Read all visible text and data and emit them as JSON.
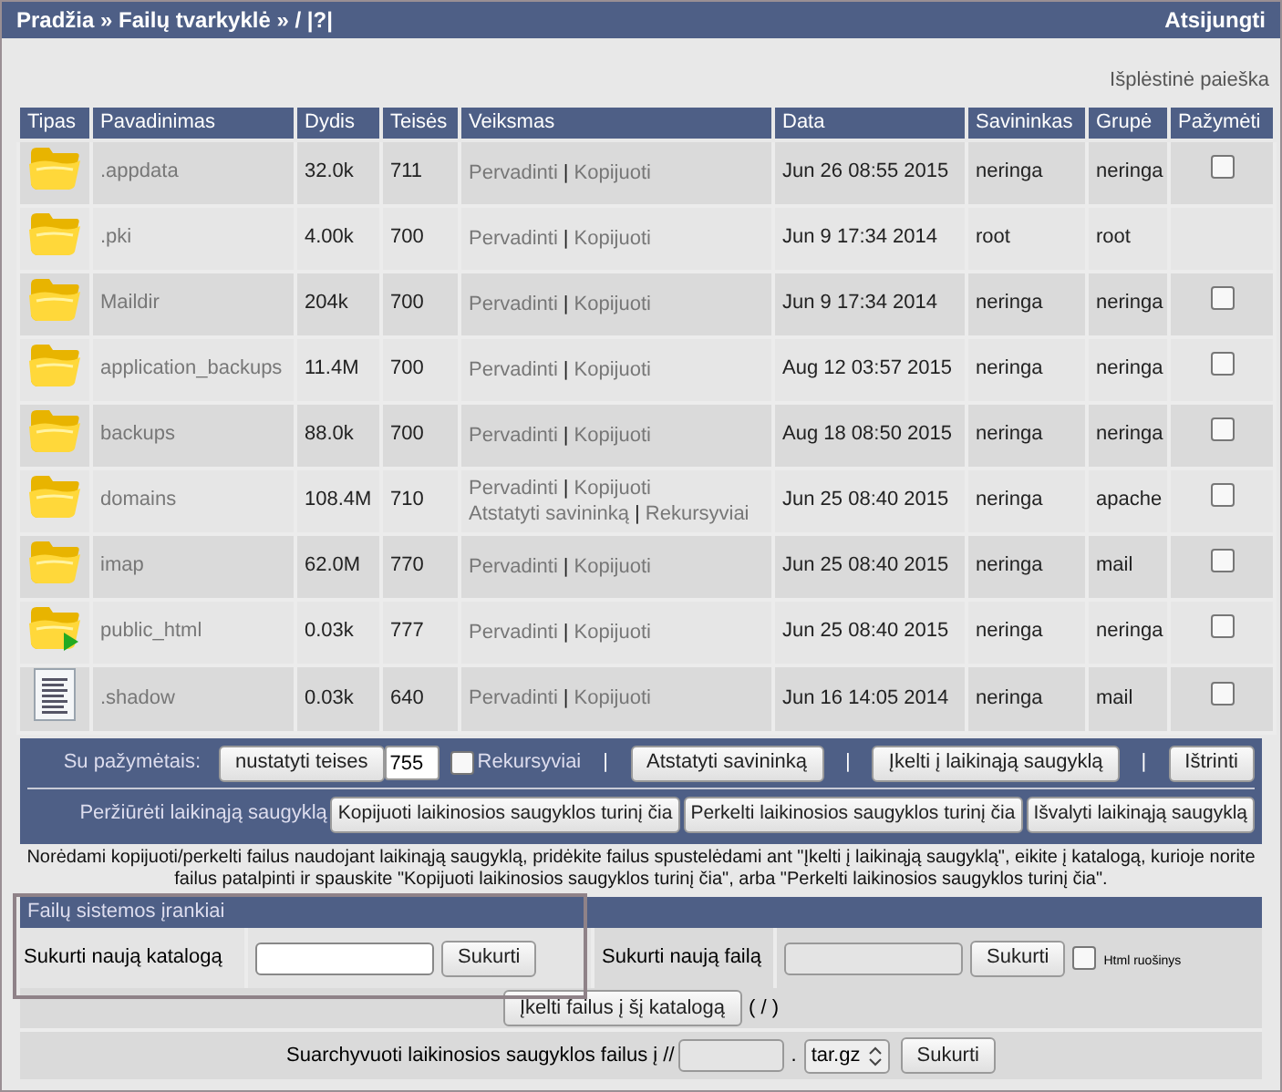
{
  "top_bar": {
    "breadcrumb": "Pradžia » Failų tvarkyklė » / |?|",
    "logout": "Atsijungti"
  },
  "advanced_search": "Išplėstinė paieška",
  "table": {
    "columns": [
      "Tipas",
      "Pavadinimas",
      "Dydis",
      "Teisės",
      "Veiksmas",
      "Data",
      "Savininkas",
      "Grupė",
      "Pažymėti"
    ],
    "rows": [
      {
        "kind": "folder",
        "name": ".appdata",
        "size": "32.0k",
        "perms": "711",
        "actions": [
          [
            {
              "kind": "link",
              "text": "Pervadinti"
            },
            {
              "kind": "separator",
              "text": "|"
            },
            {
              "kind": "link",
              "text": "Kopijuoti"
            }
          ]
        ],
        "date": "Jun 26 08:55 2015",
        "owner": "neringa",
        "group": "neringa",
        "checked": false
      },
      {
        "kind": "folder",
        "name": ".pki",
        "size": "4.00k",
        "perms": "700",
        "actions": [
          [
            {
              "kind": "link",
              "text": "Pervadinti"
            },
            {
              "kind": "separator",
              "text": "|"
            },
            {
              "kind": "link",
              "text": "Kopijuoti"
            }
          ]
        ],
        "date": "Jun 9 17:34 2014",
        "owner": "root",
        "group": "root"
      },
      {
        "kind": "folder",
        "name": "Maildir",
        "size": "204k",
        "perms": "700",
        "actions": [
          [
            {
              "kind": "link",
              "text": "Pervadinti"
            },
            {
              "kind": "separator",
              "text": "|"
            },
            {
              "kind": "link",
              "text": "Kopijuoti"
            }
          ]
        ],
        "date": "Jun 9 17:34 2014",
        "owner": "neringa",
        "group": "neringa",
        "checked": false
      },
      {
        "kind": "folder",
        "name": "application_backups",
        "size": "11.4M",
        "perms": "700",
        "actions": [
          [
            {
              "kind": "link",
              "text": "Pervadinti"
            },
            {
              "kind": "separator",
              "text": "|"
            },
            {
              "kind": "link",
              "text": "Kopijuoti"
            }
          ]
        ],
        "date": "Aug 12 03:57 2015",
        "owner": "neringa",
        "group": "neringa",
        "checked": false
      },
      {
        "kind": "folder",
        "name": "backups",
        "size": "88.0k",
        "perms": "700",
        "actions": [
          [
            {
              "kind": "link",
              "text": "Pervadinti"
            },
            {
              "kind": "separator",
              "text": "|"
            },
            {
              "kind": "link",
              "text": "Kopijuoti"
            }
          ]
        ],
        "date": "Aug 18 08:50 2015",
        "owner": "neringa",
        "group": "neringa",
        "checked": false
      },
      {
        "kind": "folder",
        "name": "domains",
        "size": "108.4M",
        "perms": "710",
        "actions": [
          [
            {
              "kind": "link",
              "text": "Pervadinti"
            },
            {
              "kind": "separator",
              "text": "|"
            },
            {
              "kind": "link",
              "text": "Kopijuoti"
            }
          ],
          [
            {
              "kind": "link",
              "text": "Atstatyti savininką"
            },
            {
              "kind": "separator",
              "text": "|"
            },
            {
              "kind": "link",
              "text": "Rekursyviai"
            }
          ]
        ],
        "date": "Jun 25 08:40 2015",
        "owner": "neringa",
        "group": "apache",
        "checked": false
      },
      {
        "kind": "folder",
        "name": "imap",
        "size": "62.0M",
        "perms": "770",
        "actions": [
          [
            {
              "kind": "link",
              "text": "Pervadinti"
            },
            {
              "kind": "separator",
              "text": "|"
            },
            {
              "kind": "link",
              "text": "Kopijuoti"
            }
          ]
        ],
        "date": "Jun 25 08:40 2015",
        "owner": "neringa",
        "group": "mail",
        "checked": false
      },
      {
        "kind": "shared",
        "name": "public_html",
        "size": "0.03k",
        "perms": "777",
        "actions": [
          [
            {
              "kind": "link",
              "text": "Pervadinti"
            },
            {
              "kind": "separator",
              "text": "|"
            },
            {
              "kind": "link",
              "text": "Kopijuoti"
            }
          ]
        ],
        "date": "Jun 25 08:40 2015",
        "owner": "neringa",
        "group": "neringa",
        "checked": false
      },
      {
        "kind": "file",
        "name": ".shadow",
        "size": "0.03k",
        "perms": "640",
        "actions": [
          [
            {
              "kind": "link",
              "text": "Pervadinti"
            },
            {
              "kind": "separator",
              "text": "|"
            },
            {
              "kind": "link",
              "text": "Kopijuoti"
            }
          ]
        ],
        "date": "Jun 16 14:05 2014",
        "owner": "neringa",
        "group": "mail",
        "checked": false
      }
    ]
  },
  "selected_bar": {
    "label": "Su pažymėtais:",
    "set_perms": "nustatyti teises",
    "perms_value": "755",
    "recursive_label": "Rekursyviai",
    "recursive_checked": false,
    "separator": "|",
    "reset_owner": "Atstatyti savininką",
    "to_clipboard": "Įkelti į laikinąją saugyklą",
    "delete": "Ištrinti"
  },
  "clipboard_bar": {
    "view": "Peržiūrėti laikinąją saugyklą",
    "copy": "Kopijuoti laikinosios saugyklos turinį čia",
    "move": "Perkelti laikinosios saugyklos turinį čia",
    "clear": "Išvalyti laikinąją saugyklą"
  },
  "help_text": "Norėdami kopijuoti/perkelti failus naudojant laikinąją saugyklą, pridėkite failus spustelėdami ant \"Įkelti į laikinąją saugyklą\", eikite į katalogą, kurioje norite failus patalpinti ir spauskite \"Kopijuoti laikinosios saugyklos turinį čia\", arba \"Perkelti laikinosios saugyklos turinį čia\".",
  "tools": {
    "title": "Failų sistemos įrankiai",
    "new_dir_label": "Sukurti naują katalogą",
    "new_dir_button": "Sukurti",
    "new_file_label": "Sukurti naują failą",
    "new_file_button": "Sukurti",
    "html_editor_label": "Html ruošinys",
    "html_editor_checked": false,
    "upload_button": "Įkelti failus į šį katalogą",
    "upload_path": "( / )",
    "archive_label": "Suarchyvuoti laikinosios saugyklos failus į //",
    "archive_dot": ".",
    "archive_format": "tar.gz",
    "archive_button": "Sukurti"
  }
}
